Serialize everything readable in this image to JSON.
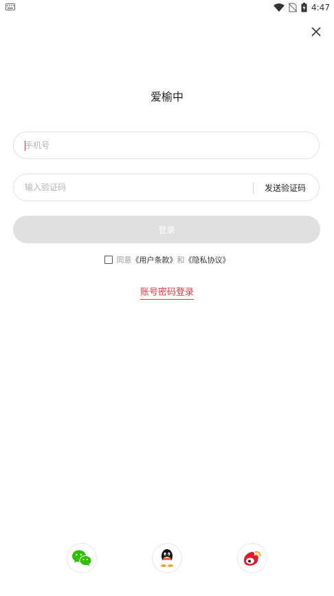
{
  "status_bar": {
    "time": "4:47"
  },
  "app": {
    "title": "爱榆中"
  },
  "form": {
    "phone_placeholder": "手机号",
    "code_placeholder": "输入验证码",
    "send_code_label": "发送验证码",
    "login_label": "登录"
  },
  "agreement": {
    "prefix": "同意",
    "user_terms": "《用户条款》",
    "conjunction": "和",
    "privacy": "《隐私协议》"
  },
  "password_login_label": "账号密码登录",
  "social_icons": [
    "wechat-icon",
    "qq-icon",
    "weibo-icon"
  ],
  "colors": {
    "accent": "#e8363c",
    "button_disabled": "#e0e0e0",
    "wechat": "#2dc100"
  }
}
